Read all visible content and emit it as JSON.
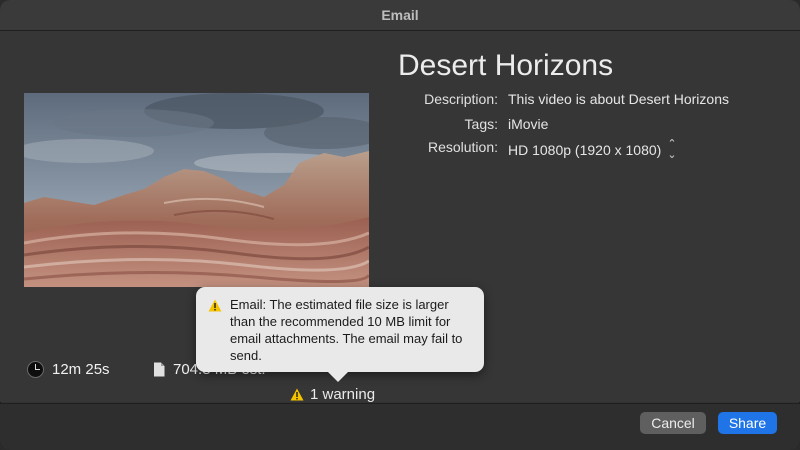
{
  "window": {
    "title": "Email"
  },
  "video": {
    "title": "Desert Horizons",
    "description_label": "Description:",
    "description": "This video is about Desert Horizons",
    "tags_label": "Tags:",
    "tags": "iMovie",
    "resolution_label": "Resolution:",
    "resolution": "HD 1080p (1920 x 1080)",
    "resolution_options_icon": "chevron-up-down-icon"
  },
  "stats": {
    "duration": "12m 25s",
    "size": "704.8 MB est.",
    "duration_icon": "clock-icon",
    "size_icon": "document-icon"
  },
  "warning": {
    "count_label": "1 warning",
    "icon": "warning-triangle-icon",
    "popover_text": "Email: The estimated file size is larger than the recommended 10 MB limit for email attachments. The email may fail to send."
  },
  "buttons": {
    "cancel": "Cancel",
    "share": "Share"
  },
  "colors": {
    "accent": "#1f74e8",
    "warning": "#f5c400",
    "background": "#363636",
    "popover": "#e9e9e9"
  }
}
